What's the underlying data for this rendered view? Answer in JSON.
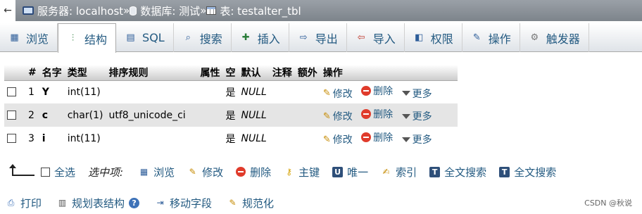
{
  "breadcrumb": {
    "back": "←",
    "server": "服务器: localhost",
    "database": "数据库: 测试",
    "table": "表: testalter_tbl",
    "separator": "»"
  },
  "tabs": [
    {
      "label": "浏览",
      "icon": "browse-icon"
    },
    {
      "label": "结构",
      "icon": "structure-icon",
      "active": true
    },
    {
      "label": "SQL",
      "icon": "sql-icon"
    },
    {
      "label": "搜索",
      "icon": "search-icon"
    },
    {
      "label": "插入",
      "icon": "insert-icon"
    },
    {
      "label": "导出",
      "icon": "export-icon"
    },
    {
      "label": "导入",
      "icon": "import-icon"
    },
    {
      "label": "权限",
      "icon": "privileges-icon"
    },
    {
      "label": "操作",
      "icon": "wrench-icon"
    },
    {
      "label": "触发器",
      "icon": "triggers-icon"
    }
  ],
  "table": {
    "headers": [
      "#",
      "名字",
      "类型",
      "排序规则",
      "属性",
      "空",
      "默认",
      "注释",
      "额外",
      "操作"
    ],
    "rows": [
      {
        "num": "1",
        "name": "Y",
        "type": "int(11)",
        "collation": "",
        "attr": "",
        "null": "是",
        "default": "NULL",
        "comment": "",
        "extra": ""
      },
      {
        "num": "2",
        "name": "c",
        "type": "char(1)",
        "collation": "utf8_unicode_ci",
        "attr": "",
        "null": "是",
        "default": "NULL",
        "comment": "",
        "extra": ""
      },
      {
        "num": "3",
        "name": "i",
        "type": "int(11)",
        "collation": "",
        "attr": "",
        "null": "是",
        "default": "NULL",
        "comment": "",
        "extra": ""
      }
    ],
    "actions": {
      "edit": "修改",
      "drop": "删除",
      "more": "更多"
    }
  },
  "bulk": {
    "select_all": "全选",
    "with_selected": "选中项:",
    "items": [
      {
        "label": "浏览",
        "icon": "browse-icon"
      },
      {
        "label": "修改",
        "icon": "pencil-icon"
      },
      {
        "label": "删除",
        "icon": "drop-icon"
      },
      {
        "label": "主键",
        "icon": "key-icon"
      },
      {
        "label": "唯一",
        "icon": "unique-icon"
      },
      {
        "label": "索引",
        "icon": "index-icon"
      },
      {
        "label": "全文搜索",
        "icon": "fulltext-icon"
      },
      {
        "label": "全文搜索",
        "icon": "fulltext-icon"
      }
    ]
  },
  "footer": {
    "print": "打印",
    "propose": "规划表结构",
    "move": "移动字段",
    "normalize": "规范化"
  },
  "watermark": "CSDN @秋说"
}
